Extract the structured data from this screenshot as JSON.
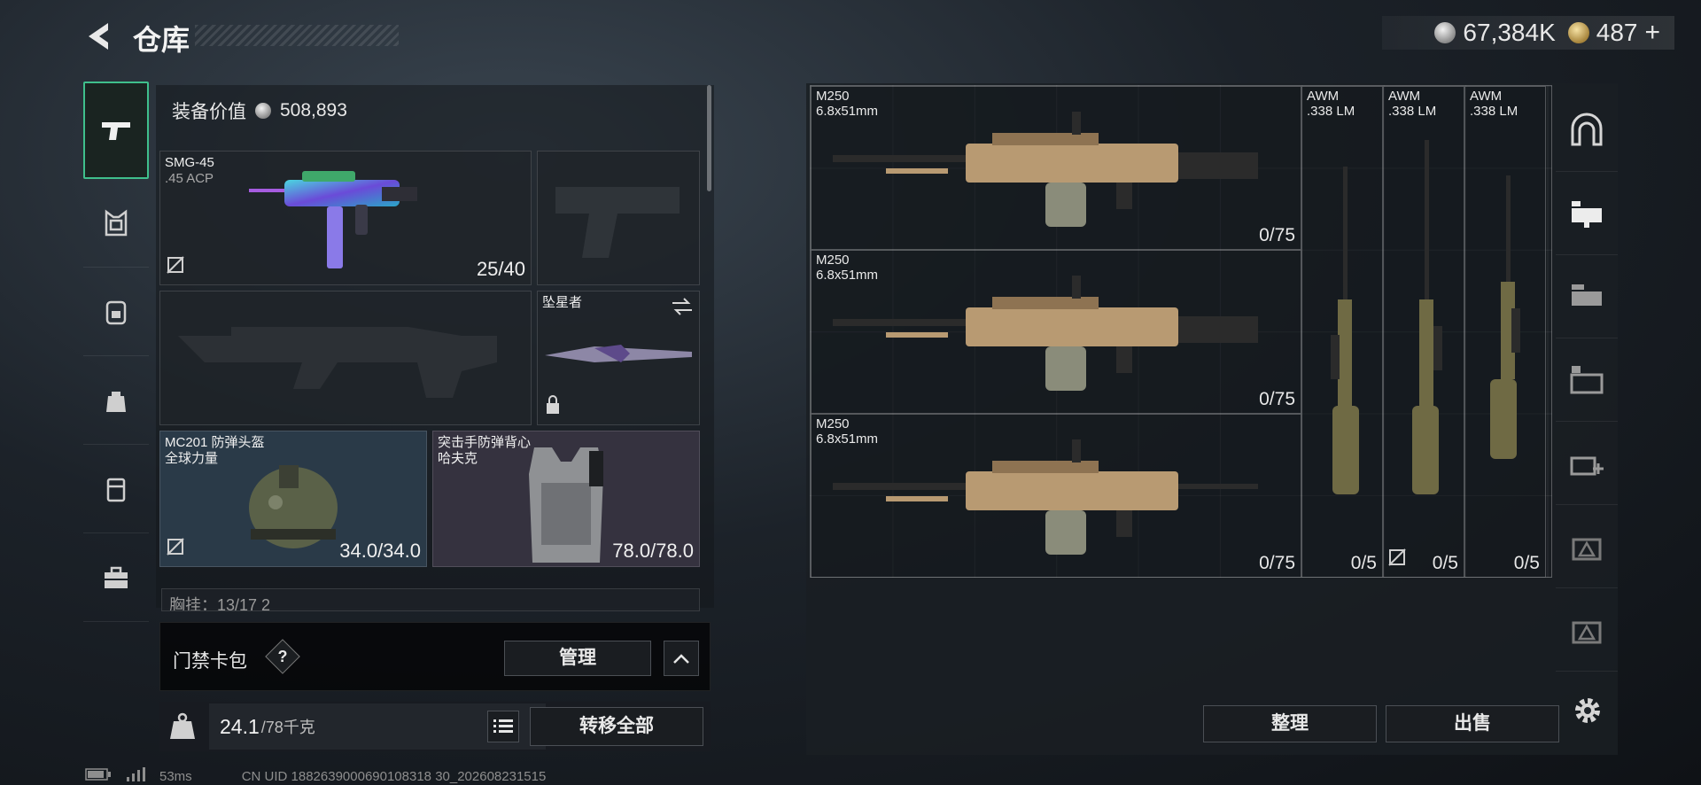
{
  "header": {
    "title": "仓库",
    "silver_amount": "67,384K",
    "gold_amount": "487",
    "add_label": "+"
  },
  "loadout": {
    "equip_value_label": "装备价值",
    "equip_value": "508,893",
    "primary": {
      "name": "SMG-45",
      "caliber": ".45 ACP",
      "count": "25/40"
    },
    "melee": {
      "name": "坠星者"
    },
    "helmet": {
      "name": "MC201 防弹头盔",
      "brand": "全球力量",
      "durability": "34.0/34.0"
    },
    "armor": {
      "name": "突击手防弹背心",
      "brand": "哈夫克",
      "durability": "78.0/78.0"
    },
    "chest_rig_partial": "胸挂：13/17  2"
  },
  "keycard": {
    "label": "门禁卡包",
    "help": "?",
    "manage_label": "管理"
  },
  "bottom": {
    "weight": "24.1",
    "weight_max": "/78千克",
    "transfer_label": "转移全部"
  },
  "stash": {
    "items": [
      {
        "name": "M250",
        "caliber": "6.8x51mm",
        "ammo": "0/75"
      },
      {
        "name": "M250",
        "caliber": "6.8x51mm",
        "ammo": "0/75"
      },
      {
        "name": "M250",
        "caliber": "6.8x51mm",
        "ammo": "0/75"
      },
      {
        "name": "AWM",
        "caliber": ".338 LM",
        "ammo": "0/5"
      },
      {
        "name": "AWM",
        "caliber": ".338 LM",
        "ammo": "0/5"
      },
      {
        "name": "AWM",
        "caliber": ".338 LM",
        "ammo": "0/5"
      }
    ],
    "sort_label": "整理",
    "sell_label": "出售"
  },
  "status": {
    "ping": "53ms",
    "uid": "CN UID 1882639000690108318 30_202608231515"
  },
  "colors": {
    "accent": "#3fbf8c",
    "helmet_bg": "#2a3a48",
    "armor_bg": "#35323f",
    "gun_tan": "#b89a72"
  }
}
